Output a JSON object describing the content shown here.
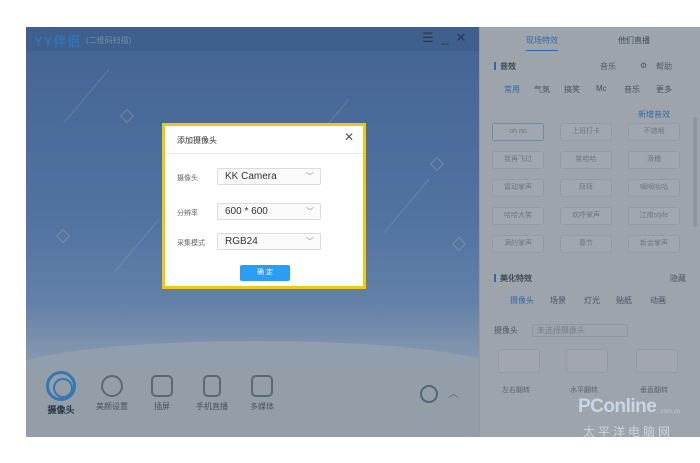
{
  "app": {
    "logo": "YY伴侣",
    "logo_sub": "(二维码扫描)",
    "menu_icon": "menu-icon",
    "minimize_icon": "minimize-icon",
    "close_icon": "close-icon"
  },
  "bottom_bar": {
    "items": [
      {
        "label": "摄像头",
        "icon": "camera-icon"
      },
      {
        "label": "美颜设置",
        "icon": "beauty-icon"
      },
      {
        "label": "插屏",
        "icon": "screen-icon"
      },
      {
        "label": "手机直播",
        "icon": "phone-icon"
      },
      {
        "label": "多媒体",
        "icon": "media-icon"
      }
    ]
  },
  "right_panel": {
    "tabs": [
      "现场特效",
      "他们直播"
    ],
    "section1": "音效",
    "option_labels": [
      "音乐",
      "帮助"
    ],
    "subtabs": [
      "常用",
      "气氛",
      "搞笑",
      "Mc",
      "音乐",
      "更多"
    ],
    "add_label": "新增音效",
    "effects": [
      "oh no",
      "上班打卡",
      "不错哦",
      "我再飞过",
      "笑哈哈",
      "滑稽",
      "雷动掌声",
      "拜拜",
      "嘀嘀咕咕",
      "哈哈大笑",
      "欢呼掌声",
      "江南style",
      "满的掌声",
      "春节",
      "新会掌声"
    ],
    "section2": "美化特效",
    "section2_more": "隐藏",
    "subtabs2": [
      "摄像头",
      "场景",
      "灯光",
      "贴纸",
      "动画"
    ],
    "camera_label": "摄像头",
    "camera_value": "未选择摄像头",
    "tools": [
      "左右翻转",
      "水平翻转",
      "垂直翻转"
    ]
  },
  "dialog": {
    "title": "添加摄像头",
    "close_icon": "close-icon",
    "fields": [
      {
        "label": "摄像头",
        "value": "KK Camera"
      },
      {
        "label": "分辨率",
        "value": "600 * 600"
      },
      {
        "label": "采集模式",
        "value": "RGB24"
      }
    ],
    "ok_label": "确 定"
  },
  "watermark": {
    "brand": "PConline",
    "sub": "太平洋电脑网",
    "url": ".com.cn"
  },
  "colors": {
    "accent": "#2b9df2",
    "dialog_border": "#f2c616",
    "stage_blue": "#5c88c8"
  }
}
